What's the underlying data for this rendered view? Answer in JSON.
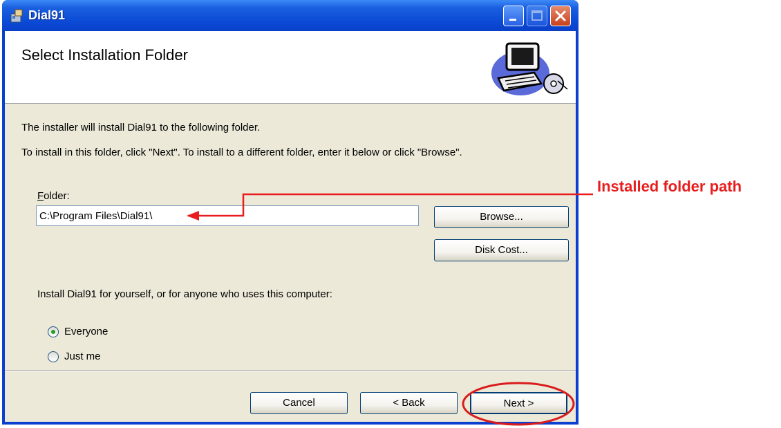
{
  "window": {
    "title": "Dial91"
  },
  "banner": {
    "title": "Select Installation Folder"
  },
  "body": {
    "line1": "The installer will install Dial91 to the following folder.",
    "line2": "To install in this folder, click \"Next\". To install to a different folder, enter it below or click \"Browse\"."
  },
  "folder": {
    "label_accel": "F",
    "label_rest": "older:",
    "value": "C:\\Program Files\\Dial91\\"
  },
  "buttons": {
    "browse": "Browse...",
    "disk_cost": "Disk Cost...",
    "cancel": "Cancel",
    "back": "< Back",
    "next": "Next >"
  },
  "install_for": {
    "prompt": "Install Dial91 for yourself, or for anyone who uses this computer:",
    "options": [
      "Everyone",
      "Just me"
    ],
    "selected": "Everyone"
  },
  "annotation": {
    "label": "Installed folder path",
    "color": "#e81e1e"
  },
  "icons": {
    "app": "installer-package-icon",
    "banner": "computer-with-cd-icon"
  }
}
